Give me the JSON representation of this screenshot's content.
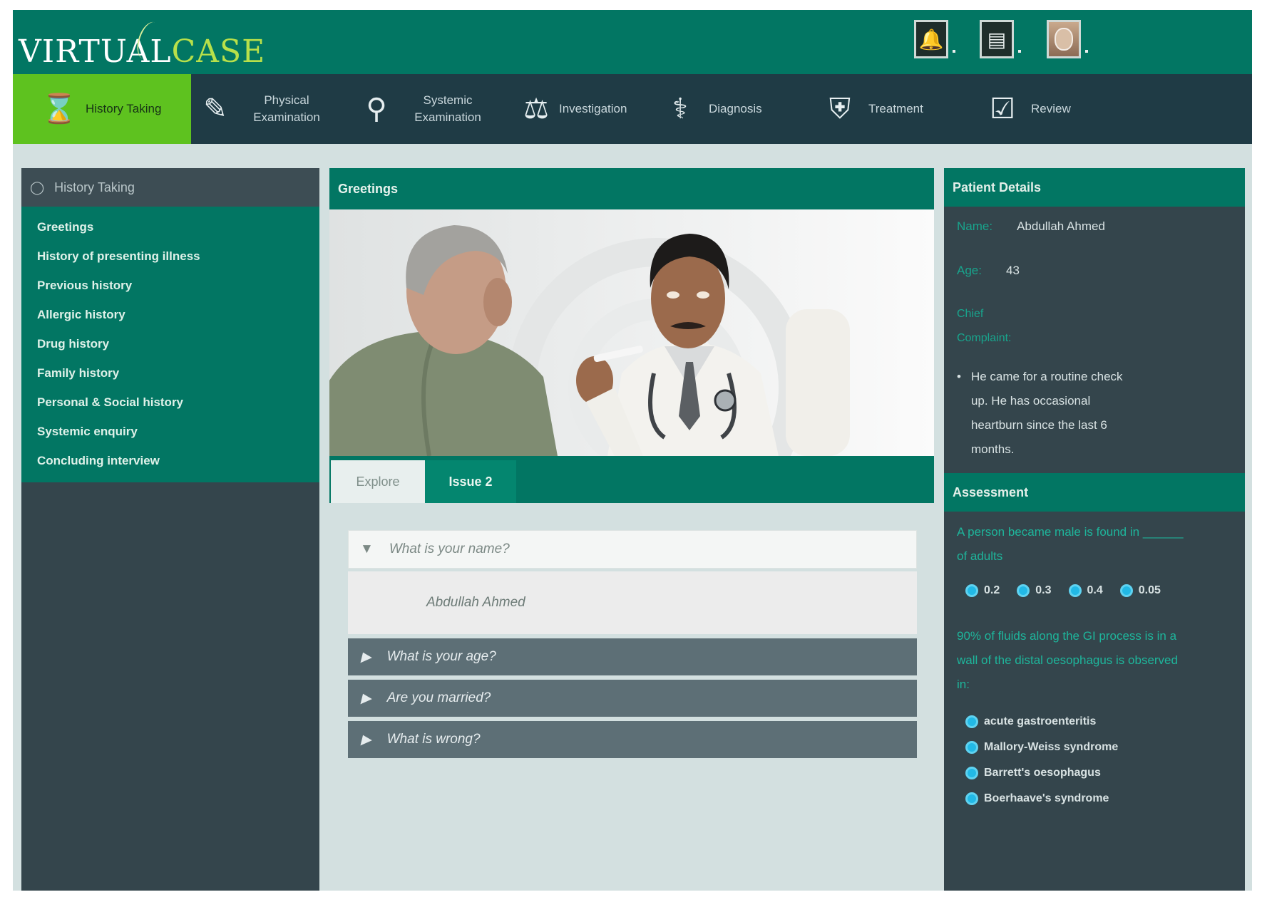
{
  "app": {
    "logo_part1": "VIRTUAL",
    "logo_part2": "CASE"
  },
  "header": {
    "icons": [
      "bell-icon",
      "notebook-icon",
      "user-avatar"
    ]
  },
  "nav": [
    {
      "label": "History Taking",
      "icon": "hourglass-icon",
      "active": true
    },
    {
      "label": "Physical Examination",
      "icon": "tools-icon",
      "active": false
    },
    {
      "label": "Systemic Examination",
      "icon": "magnifier-icon",
      "active": false
    },
    {
      "label": "Investigation",
      "icon": "microscope-icon",
      "active": false
    },
    {
      "label": "Diagnosis",
      "icon": "stethoscope-icon",
      "active": false
    },
    {
      "label": "Treatment",
      "icon": "medical-kit-icon",
      "active": false
    },
    {
      "label": "Review",
      "icon": "review-badge-icon",
      "active": false
    }
  ],
  "left_panel": {
    "title": "History Taking",
    "items": [
      "Greetings",
      "History of presenting illness",
      "Previous history",
      "Allergic history",
      "Drug history",
      "Family history",
      "Personal & Social history",
      "Systemic enquiry",
      "Concluding interview"
    ]
  },
  "center": {
    "title": "Greetings",
    "tabs": [
      "Explore",
      "Issue 2"
    ],
    "accordion": {
      "open_question": "What is your name?",
      "open_answer": "Abdullah Ahmed",
      "closed_questions": [
        "What is your age?",
        "Are you married?",
        "What is wrong?"
      ]
    }
  },
  "patient": {
    "title": "Patient Details",
    "name_label": "Name:",
    "name_value": "Abdullah Ahmed",
    "age_label": "Age:",
    "age_value": "43",
    "complaint_label_1": "Chief",
    "complaint_label_2": "Complaint:",
    "complaint_lines": [
      "He came for a routine check",
      "up. He has occasional",
      "heartburn since the last 6",
      "months."
    ]
  },
  "assessment": {
    "title": "Assessment",
    "q1_lines": [
      "A person became male is found in ______",
      "of adults"
    ],
    "q1_options": [
      "0.2",
      "0.3",
      "0.4",
      "0.05"
    ],
    "q2_lines": [
      "90% of fluids along the GI process is in a",
      "wall of the distal oesophagus is observed",
      "in:"
    ],
    "q2_options": [
      "acute gastroenteritis",
      "Mallory-Weiss syndrome",
      "Barrett's oesophagus",
      "Boerhaave's syndrome"
    ]
  },
  "colors": {
    "header_teal": "#027663",
    "nav_dark": "#1f3b45",
    "active_green": "#5ec21f",
    "panel_slate": "#34454c",
    "accent_text": "#18a58d",
    "radio_blue": "#22b9e6"
  }
}
